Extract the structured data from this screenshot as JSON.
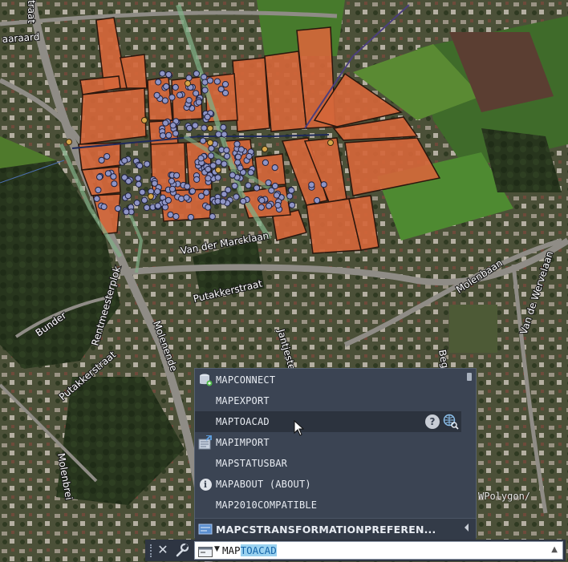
{
  "map": {
    "street_labels": [
      "Van der Marcklaan",
      "Putakkerstraat",
      "Molenbaan",
      "Van de Wervelaan",
      "Rentmeesterplok",
      "Molenende",
      "Bunder",
      "Putakkerstraat",
      "Molenbrei",
      "aaraard",
      "traat",
      "Beg",
      "Jantjeste"
    ],
    "overlay_text": "WPolygon/"
  },
  "autocomplete": {
    "items": [
      {
        "label": "MAPCONNECT",
        "icon": "database-connect-icon"
      },
      {
        "label": "MAPEXPORT",
        "icon": ""
      },
      {
        "label": "MAPTOACAD",
        "icon": "",
        "hovered": true
      },
      {
        "label": "MAPIMPORT",
        "icon": "map-import-icon"
      },
      {
        "label": "MAPSTATUSBAR",
        "icon": ""
      },
      {
        "label": "MAPABOUT (ABOUT)",
        "icon": "info-icon"
      },
      {
        "label": "MAP2010COMPATIBLE",
        "icon": ""
      }
    ],
    "hover_actions": [
      "help-icon",
      "search-web-icon"
    ],
    "header": {
      "label": "MAPCSTRANSFORMATIONPREFEREN...",
      "icon": "map-system-variable-icon"
    }
  },
  "command_line": {
    "typed": "MAP",
    "autocomplete_suffix": "TOACAD"
  },
  "colors": {
    "parcel_fill": "#d4663a",
    "parcel_stroke": "#2a160d",
    "point_fill": "#8f95c6",
    "popup_bg": "#3b4453",
    "cmdline_bg": "#2e3542",
    "selection": "#9ad2f0"
  }
}
